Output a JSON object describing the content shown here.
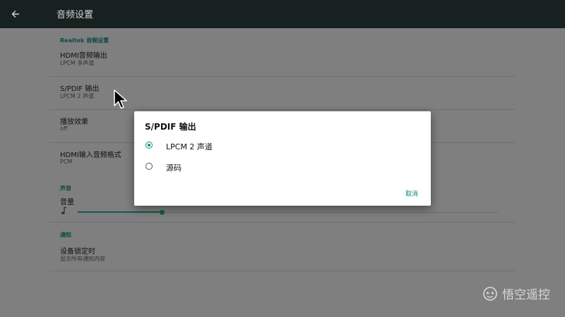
{
  "header": {
    "title": "音频设置",
    "back_icon": "arrow-left-icon"
  },
  "sections": {
    "realtek": {
      "header": "Realtek 音频设置",
      "items": [
        {
          "title": "HDMI音频输出",
          "summary": "LPCM 多声道"
        },
        {
          "title": "S/PDIF 输出",
          "summary": "LPCM 2 声道"
        },
        {
          "title": "播放效果",
          "summary": "off"
        },
        {
          "title": "HDMI输入音频格式",
          "summary": "PCM"
        }
      ]
    },
    "sound": {
      "header": "声音",
      "volume": {
        "title": "音量",
        "icon": "music-note-icon",
        "level": 0.2
      }
    },
    "notification": {
      "header": "通知",
      "items": [
        {
          "title": "设备锁定时",
          "summary": "显示所有通知内容"
        }
      ]
    }
  },
  "dialog": {
    "title": "S/PDIF 输出",
    "options": [
      {
        "label": "LPCM 2 声道",
        "checked": true
      },
      {
        "label": "源码",
        "checked": false
      }
    ],
    "cancel_label": "取消"
  },
  "watermark": {
    "text": "悟空遥控",
    "icon": "monkey-face-icon"
  },
  "colors": {
    "accent": "#0e8a7a",
    "appbar": "#17211f",
    "scrim_background": "#7f7f7f"
  }
}
